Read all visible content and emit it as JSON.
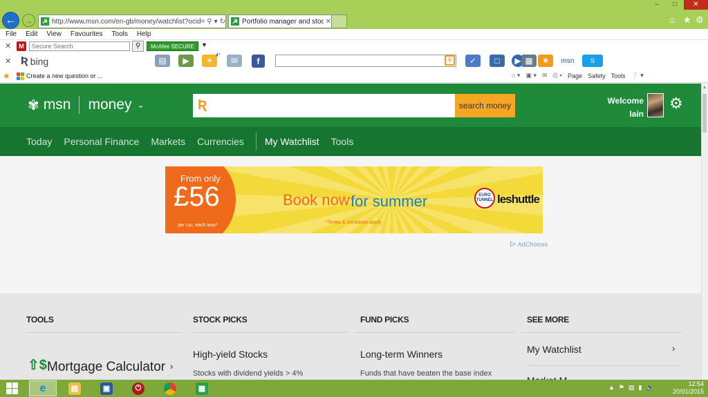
{
  "browser": {
    "url": "http://www.msn.com/en-gb/money/watchlist?ocid=/",
    "tab_title": "Portfolio manager and stoc...",
    "address_go_icon": "search-icon",
    "refresh_icon": "refresh-icon",
    "menu": [
      "File",
      "Edit",
      "View",
      "Favourites",
      "Tools",
      "Help"
    ],
    "mcafee": {
      "search_placeholder": "Secure Search",
      "secure_label": "McAfee SECURE"
    },
    "bing_label": "bing",
    "favourites_link": "Create a new question or ...",
    "command_bar": {
      "page": "Page",
      "safety": "Safety",
      "tools": "Tools"
    },
    "toolbar_degree": "4°"
  },
  "msn": {
    "brand": "msn",
    "section": "money",
    "search_button": "search money",
    "welcome_line1": "Welcome",
    "welcome_line2": "Iain",
    "nav": [
      "Today",
      "Personal Finance",
      "Markets",
      "Currencies",
      "My Watchlist",
      "Tools"
    ],
    "nav_active": "My Watchlist"
  },
  "ad": {
    "from_text": "From only",
    "price": "£56",
    "per_car": "per car, each way*",
    "book_now": "Book now",
    "for_summer": "for summer",
    "terms": "*Terms & conditions apply",
    "eurotunnel": "EURO TUNNEL",
    "brand": "leshuttle",
    "adchoices": "AdChoices"
  },
  "sections": {
    "tools": {
      "heading": "TOOLS",
      "item": "Mortgage Calculator"
    },
    "stock_picks": {
      "heading": "STOCK PICKS",
      "item": "High-yield Stocks",
      "sub": "Stocks with dividend yields > 4%"
    },
    "fund_picks": {
      "heading": "FUND PICKS",
      "item": "Long-term Winners",
      "sub": "Funds that have beaten the base index"
    },
    "see_more": {
      "heading": "SEE MORE",
      "item": "My Watchlist",
      "next_item_partial": "Market M..."
    }
  },
  "taskbar": {
    "time": "12:54",
    "date": "20/01/2015",
    "apps": [
      "internet-explorer",
      "file-explorer",
      "network-app",
      "power-app",
      "chrome",
      "windows-store"
    ]
  },
  "colors": {
    "msn_green": "#1e8a3a",
    "msn_nav_green": "#167530",
    "search_button": "#f5a623",
    "ie_frame": "#a8cf58",
    "taskbar": "#7fa83a"
  }
}
